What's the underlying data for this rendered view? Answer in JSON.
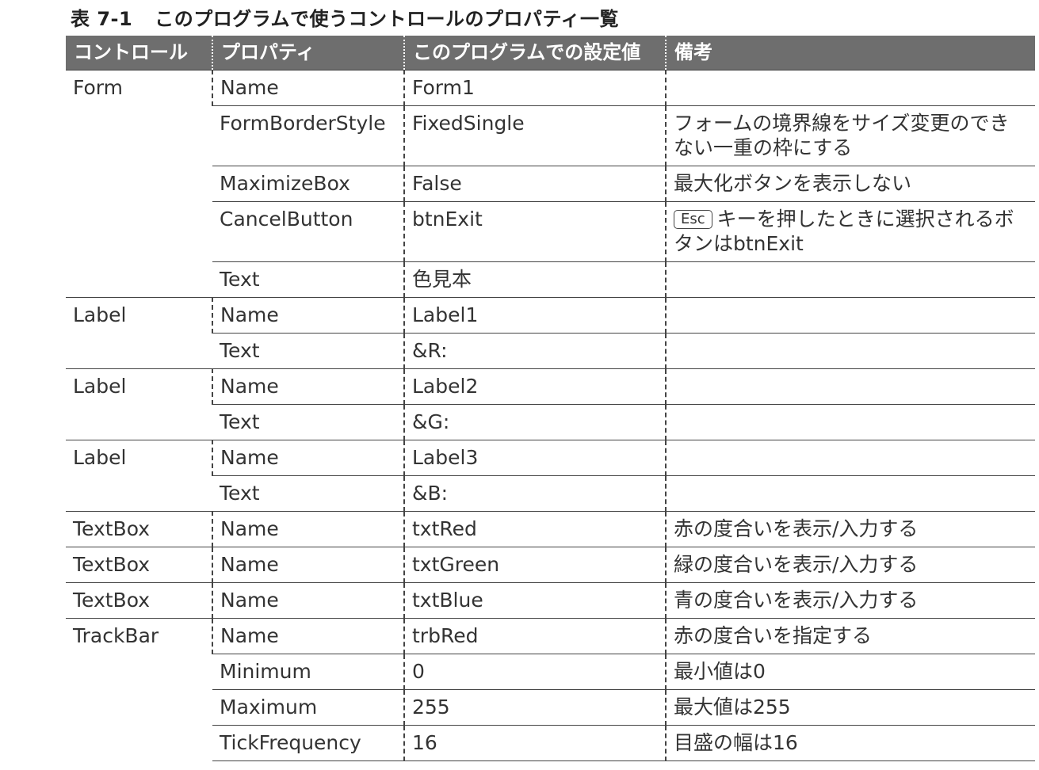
{
  "caption": {
    "label": "表 7-1",
    "title": "このプログラムで使うコントロールのプロパティ一覧"
  },
  "headers": [
    "コントロール",
    "プロパティ",
    "このプログラムでの設定値",
    "備考"
  ],
  "groups": [
    {
      "control": "Form",
      "rows": [
        {
          "property": "Name",
          "value": "Form1",
          "note": ""
        },
        {
          "property": "FormBorderStyle",
          "value": "FixedSingle",
          "note": "フォームの境界線をサイズ変更のできない一重の枠にする"
        },
        {
          "property": "MaximizeBox",
          "value": "False",
          "note": "最大化ボタンを表示しない"
        },
        {
          "property": "CancelButton",
          "value": "btnExit",
          "note_key": "Esc",
          "note": "キーを押したときに選択されるボタンはbtnExit"
        },
        {
          "property": "Text",
          "value": "色見本",
          "note": ""
        }
      ]
    },
    {
      "control": "Label",
      "rows": [
        {
          "property": "Name",
          "value": "Label1",
          "note": ""
        },
        {
          "property": "Text",
          "value": "&R:",
          "note": ""
        }
      ]
    },
    {
      "control": "Label",
      "rows": [
        {
          "property": "Name",
          "value": "Label2",
          "note": ""
        },
        {
          "property": "Text",
          "value": "&G:",
          "note": ""
        }
      ]
    },
    {
      "control": "Label",
      "rows": [
        {
          "property": "Name",
          "value": "Label3",
          "note": ""
        },
        {
          "property": "Text",
          "value": "&B:",
          "note": ""
        }
      ]
    },
    {
      "control": "TextBox",
      "rows": [
        {
          "property": "Name",
          "value": "txtRed",
          "note": "赤の度合いを表示/入力する"
        }
      ]
    },
    {
      "control": "TextBox",
      "rows": [
        {
          "property": "Name",
          "value": "txtGreen",
          "note": "緑の度合いを表示/入力する"
        }
      ]
    },
    {
      "control": "TextBox",
      "rows": [
        {
          "property": "Name",
          "value": "txtBlue",
          "note": "青の度合いを表示/入力する"
        }
      ]
    },
    {
      "control": "TrackBar",
      "rows": [
        {
          "property": "Name",
          "value": "trbRed",
          "note": "赤の度合いを指定する"
        },
        {
          "property": "Minimum",
          "value": "0",
          "note": "最小値は0"
        },
        {
          "property": "Maximum",
          "value": "255",
          "note": "最大値は255"
        },
        {
          "property": "TickFrequency",
          "value": "16",
          "note": "目盛の幅は16"
        }
      ]
    }
  ]
}
